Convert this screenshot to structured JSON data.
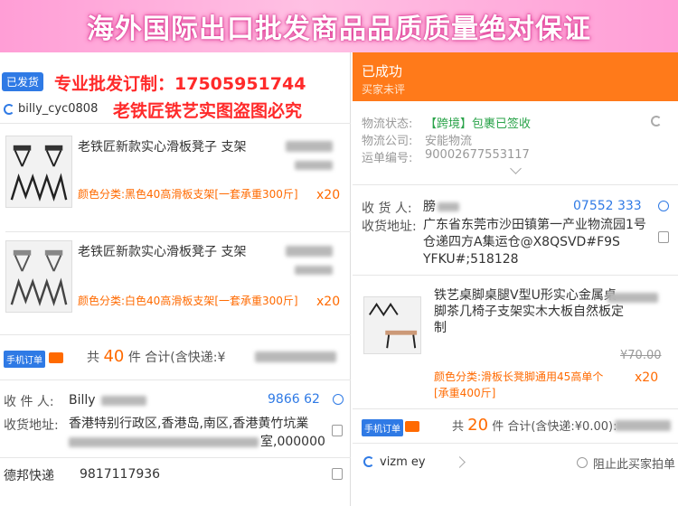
{
  "banner": "海外国际出口批发商品品质质量绝对保证",
  "watermark": {
    "line1": "专业批发订制：17505951744",
    "line2": "老铁匠铁艺实图盗图必究"
  },
  "left": {
    "status_badge": "已发货",
    "username": "billy_cyc0808",
    "items": [
      {
        "title": "老铁匠新款实心滑板凳子 支架",
        "spec": "颜色分类:黑色40高滑板支架[一套承重300斤]",
        "qty": "x20"
      },
      {
        "title": "老铁匠新款实心滑板凳子 支架",
        "spec": "颜色分类:白色40高滑板支架[一套承重300斤]",
        "qty": "x20"
      }
    ],
    "mobile_order": "手机订单",
    "summary_prefix": "共",
    "summary_count": "40",
    "summary_mid": "件 合计(含快递:¥",
    "receiver_label": "收 件 人:",
    "receiver_value": "Billy",
    "receiver_phone": "9866   62",
    "address_label": "收货地址:",
    "address_value": "香港特别行政区,香港岛,南区,香港黄竹坑業",
    "address_value2": "室,000000",
    "courier_label": "德邦快递",
    "courier_number": "9817117936"
  },
  "right": {
    "status_title": "已成功",
    "status_sub": "买家未评",
    "logistics_status_label": "物流状态:",
    "logistics_status_value": "【跨境】包裹已签收",
    "logistics_company_label": "物流公司:",
    "logistics_company_value": "安能物流",
    "tracking_label": "运单编号:",
    "tracking_value": "90002677553117",
    "receiver_label": "收 货 人:",
    "receiver_value": "膀",
    "receiver_phone": "07552      333",
    "address_label": "收货地址:",
    "address_value": "广东省东莞市沙田镇第一产业物流园1号仓递四方A集运仓@X8QSVD#F9S         YFKU#;518128",
    "item_title": "铁艺桌脚桌腿V型U形实心金属桌脚茶几椅子支架实木大板自然板定制",
    "item_old_price": "¥70.00",
    "item_spec": "颜色分类:滑板长凳脚通用45高单个[承重400斤]",
    "item_qty": "x20",
    "mobile_order": "手机订单",
    "summary_prefix": "共",
    "summary_count": "20",
    "summary_mid": "件 合计(含快递:¥0.00):",
    "buyer": "vizm      ey",
    "block_label": "阻止此买家拍单"
  }
}
